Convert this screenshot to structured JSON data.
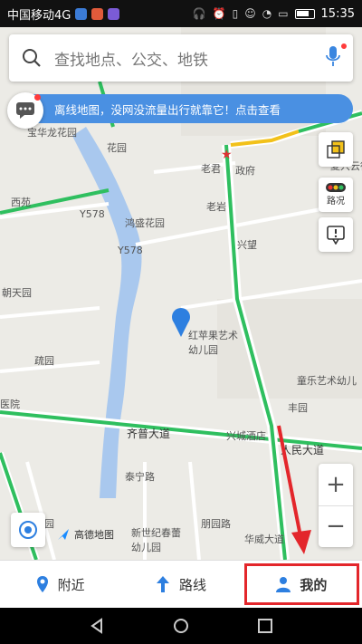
{
  "status_bar": {
    "carrier": "中国移动4G",
    "time": "15:35",
    "icons": [
      "headphones-icon",
      "alarm-icon",
      "vibrate-icon",
      "smile-icon",
      "wifi-icon",
      "message-icon",
      "battery-icon"
    ]
  },
  "search": {
    "placeholder": "查找地点、公交、地铁",
    "mic_icon": "mic-icon"
  },
  "banner": {
    "text": "离线地图，没网没流量出行就靠它！点击查看"
  },
  "side_controls": {
    "layers_icon": "layers-icon",
    "traffic_label": "路况",
    "report_icon": "report-icon"
  },
  "map": {
    "labels": {
      "baolong": "宝华龙花园",
      "huayuan": "花园",
      "yuequanchou": "夏兴云德",
      "laojun": "老君",
      "zhengfu": "政府",
      "y578a": "Y578",
      "hongsheng": "鸿盛花园",
      "y578b": "Y578",
      "laoyuan": "老岩",
      "xingwang": "兴望",
      "xiyuan": "西苑",
      "hongping": "红苹果艺术幼儿园",
      "chaowu": "朝天园",
      "tonglezhi": "童乐艺术幼儿",
      "qi": "齐普大道",
      "xingcheng": "兴城酒店",
      "renmin": "人民大道",
      "taiyuan": "泰宁路",
      "xinshiji": "新世纪春蕾幼儿园",
      "penglu": "朋园路",
      "huawei": "华威大道",
      "er": "儿园",
      "yi": "医院",
      "fengyuan": "丰园",
      "shuyuan": "疏园"
    }
  },
  "brand": {
    "name": "高德地图"
  },
  "tabs": [
    {
      "label": "附近",
      "icon": "location-pin-icon"
    },
    {
      "label": "路线",
      "icon": "route-arrow-icon"
    },
    {
      "label": "我的",
      "icon": "user-icon"
    }
  ],
  "colors": {
    "accent": "#4a90e2",
    "route_green": "#2fbf5f",
    "highlight_red": "#e3262b"
  }
}
